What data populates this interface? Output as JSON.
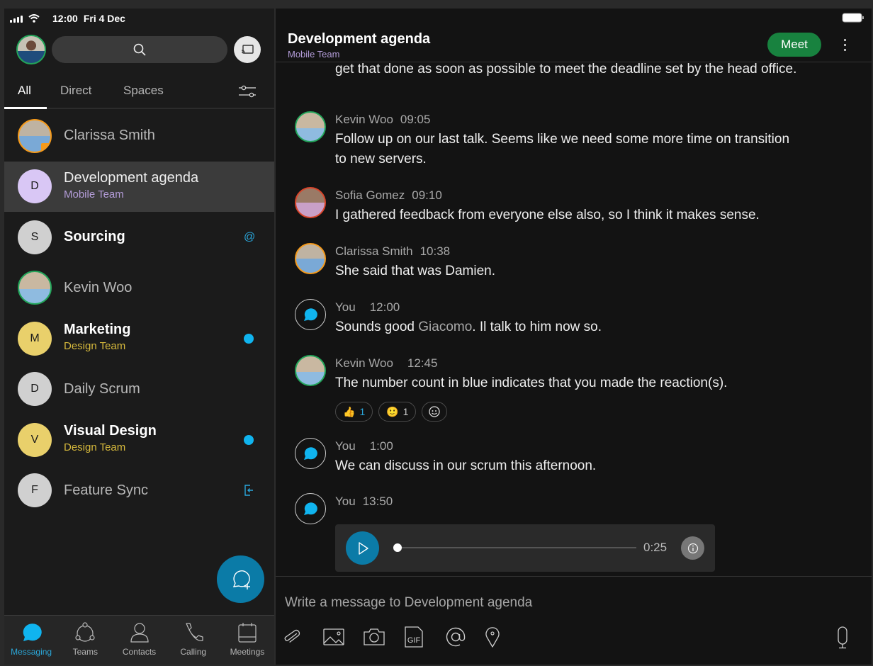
{
  "status_bar": {
    "time": "12:00",
    "date": "Fri 4 Dec"
  },
  "left": {
    "search_icon": "search-icon",
    "cast_icon": "screen-share-icon",
    "tabs": [
      {
        "label": "All",
        "active": true
      },
      {
        "label": "Direct",
        "active": false
      },
      {
        "label": "Spaces",
        "active": false
      }
    ],
    "filter_icon": "filter-sliders-icon",
    "conversations": [
      {
        "name": "Clarissa Smith",
        "type": "person",
        "presence": "in-meeting",
        "presence_color": "#f59a1b"
      },
      {
        "name": "Development agenda",
        "initial": "D",
        "subtitle": "Mobile Team",
        "subtitle_color": "#b39cd8",
        "avatar_color": "#d9c7f5",
        "selected": true
      },
      {
        "name": "Sourcing",
        "initial": "S",
        "bold": true,
        "avatar_color": "#d0d0d0",
        "indicator": "mention-icon"
      },
      {
        "name": "Kevin Woo",
        "type": "person",
        "presence": "available",
        "presence_color": "#23a55a"
      },
      {
        "name": "Marketing",
        "initial": "M",
        "subtitle": "Design Team",
        "subtitle_color": "#d6b93c",
        "bold": true,
        "avatar_color": "#e9d06b",
        "indicator": "unread-dot"
      },
      {
        "name": "Daily Scrum",
        "initial": "D",
        "avatar_color": "#d0d0d0"
      },
      {
        "name": "Visual Design",
        "initial": "V",
        "subtitle": "Design Team",
        "subtitle_color": "#d6b93c",
        "bold": true,
        "avatar_color": "#e9d06b",
        "indicator": "unread-dot"
      },
      {
        "name": "Feature Sync",
        "initial": "F",
        "avatar_color": "#d0d0d0",
        "indicator": "join-icon"
      }
    ],
    "fab_icon": "new-message-icon",
    "nav": [
      {
        "label": "Messaging",
        "icon": "messaging-icon",
        "active": true
      },
      {
        "label": "Teams",
        "icon": "teams-icon",
        "active": false
      },
      {
        "label": "Contacts",
        "icon": "contacts-icon",
        "active": false
      },
      {
        "label": "Calling",
        "icon": "phone-icon",
        "active": false
      },
      {
        "label": "Meetings",
        "icon": "calendar-icon",
        "active": false
      }
    ]
  },
  "chat": {
    "title": "Development agenda",
    "subtitle": "Mobile Team",
    "meet_label": "Meet",
    "continued_text": "get that done as soon as possible to meet the deadline set by the head office.",
    "messages": [
      {
        "sender": "Kevin Woo",
        "time": "09:05",
        "text": "Follow up on our last talk. Seems like we need some more time on transition to new servers.",
        "presence_color": "#23a55a"
      },
      {
        "sender": "Sofia Gomez",
        "time": "09:10",
        "text": "I gathered feedback from everyone else also, so I think it makes sense.",
        "presence_color": "#d9452b"
      },
      {
        "sender": "Clarissa Smith",
        "time": "10:38",
        "text": "She said that was Damien.",
        "presence_color": "#f59a1b"
      },
      {
        "sender": "You",
        "time": "12:00",
        "text_before": "Sounds good ",
        "mention": "Giacomo",
        "text_after": ". Il talk to him now so."
      },
      {
        "sender": "Kevin Woo",
        "time": "12:45",
        "text": "The number count in blue indicates that you made the reaction(s).",
        "presence_color": "#23a55a",
        "reactions": [
          {
            "emoji": "👍",
            "count": "1",
            "mine": true
          },
          {
            "emoji": "🙂",
            "count": "1",
            "mine": false
          }
        ]
      },
      {
        "sender": "You",
        "time": "1:00",
        "text": "We can discuss in our scrum this afternoon."
      },
      {
        "sender": "You",
        "time": "13:50",
        "audio": {
          "duration": "0:25",
          "progress": 0
        }
      }
    ],
    "composer": {
      "placeholder": "Write a message to Development agenda",
      "tools": [
        "attach-icon",
        "image-icon",
        "camera-icon",
        "gif-icon",
        "mention-icon",
        "location-icon"
      ],
      "mic_icon": "microphone-icon"
    }
  }
}
